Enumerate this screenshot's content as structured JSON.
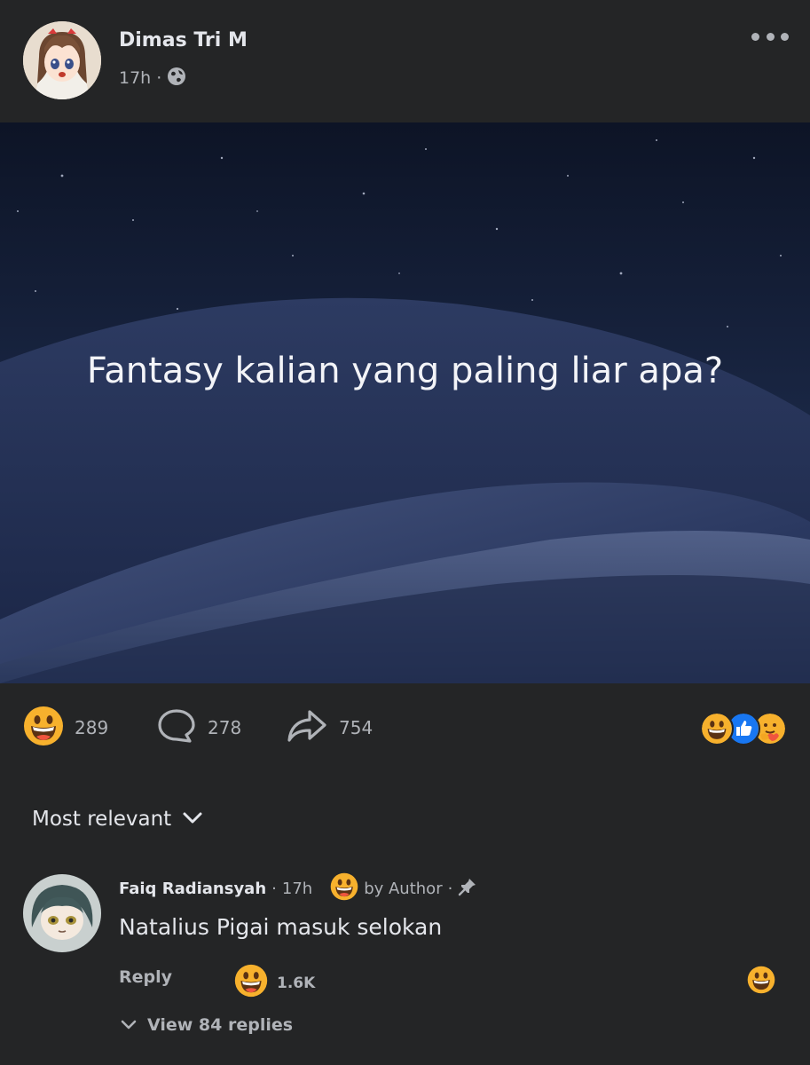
{
  "post": {
    "author_name": "Dimas Tri M",
    "timestamp": "17h",
    "separator": "·",
    "privacy_icon": "globe-icon",
    "more_icon": "more-horizontal-icon",
    "image_text": "Fantasy kalian yang paling liar apa?"
  },
  "stats": {
    "reactions_count": "289",
    "comments_count": "278",
    "shares_count": "754",
    "reaction_types": [
      "grinning-face-icon",
      "like-icon",
      "care-icon"
    ]
  },
  "comments_section": {
    "sort_label": "Most relevant",
    "comment": {
      "author_name": "Faiq Radiansyah",
      "separator": "·",
      "timestamp": "17h",
      "author_reaction_label": "by Author",
      "pin_separator": "·",
      "text": "Natalius Pigai masuk selokan",
      "reply_label": "Reply",
      "reaction_count": "1.6K",
      "view_replies_label": "View 84 replies"
    }
  },
  "colors": {
    "background": "#242526",
    "text_primary": "#e4e6eb",
    "text_secondary": "#b0b3b8",
    "like_blue": "#1877f2"
  }
}
